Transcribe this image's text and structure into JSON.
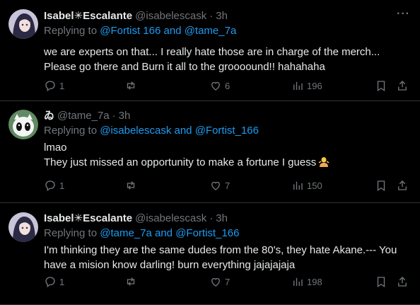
{
  "tweets": [
    {
      "name": "Isabel✳Escalante",
      "handle": "@isabelescask",
      "dot": "·",
      "time": "3h",
      "replying_prefix": "Replying to",
      "replying_to": [
        "@Fortist 166",
        "@tame_7a"
      ],
      "replying_join": "and",
      "lines": [
        "we are experts on that... I really hate those are in charge of the merch...",
        "Please go there and Burn it all to the groooound!! hahahaha"
      ],
      "replies": "1",
      "likes": "6",
      "views": "196",
      "avatar_colors": {
        "bg": "#c9c4d8",
        "hair": "#2a2a44",
        "face": "#f3e0dc"
      }
    },
    {
      "name": "ゐ",
      "handle": "@tame_7a",
      "dot": "·",
      "time": "3h",
      "replying_prefix": "Replying to",
      "replying_to": [
        "@isabelescask",
        "@Fortist_166"
      ],
      "replying_join": "and",
      "lines": [
        "lmao",
        "They just missed an opportunity to make a fortune I guess"
      ],
      "emoji": "person-shrugging-emoji",
      "replies": "1",
      "likes": "7",
      "views": "150",
      "avatar_colors": {
        "bg": "#5f8a63",
        "face": "#f4f4f4",
        "eyes": "#111111"
      }
    },
    {
      "name": "Isabel✳Escalante",
      "handle": "@isabelescask",
      "dot": "·",
      "time": "3h",
      "replying_prefix": "Replying to",
      "replying_to": [
        "@tame_7a",
        "@Fortist_166"
      ],
      "replying_join": "and",
      "lines": [
        "I'm thinking they are the same dudes from the 80's, they hate Akane.--- You",
        "have a mision know darling! burn everything jajajajaja"
      ],
      "replies": "1",
      "likes": "7",
      "views": "198",
      "avatar_colors": {
        "bg": "#c9c4d8",
        "hair": "#2a2a44",
        "face": "#f3e0dc"
      }
    }
  ],
  "ui": {
    "more_label": "···",
    "colors": {
      "accent": "#1d9bf0",
      "muted": "#71767b",
      "text": "#e7e9ea",
      "divider": "#2f3336"
    }
  }
}
